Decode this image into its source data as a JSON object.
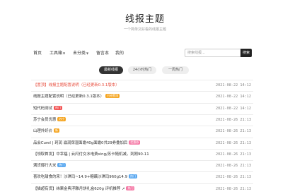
{
  "site": {
    "title": "线报主题",
    "subtitle": "一个简单又好看的线报主题"
  },
  "nav": {
    "items": [
      {
        "label": "首页"
      },
      {
        "label": "工具箱"
      },
      {
        "label": "未分类"
      },
      {
        "label": "留言本"
      },
      {
        "label": "我的"
      }
    ],
    "search_placeholder": "搜索线报...",
    "search_button": "搜索"
  },
  "tabs": [
    {
      "label": "最新线报",
      "active": true
    },
    {
      "label": "24小时热门",
      "active": false
    },
    {
      "label": "一周热门",
      "active": false
    }
  ],
  "news": [
    {
      "title": "【置顶】线报主题配置说明（已经更新0.3.1版本）",
      "color": "red",
      "badge": "",
      "badge_color": "",
      "time": "2021-08-22 14:12"
    },
    {
      "title": "线报主题配置说明（已经更新0.3.1版本）",
      "color": "normal",
      "badge": "已经置顶",
      "badge_color": "orange",
      "time": "2021-08-22 14:12"
    },
    {
      "title": "短代码测试",
      "color": "normal",
      "badge": "热门",
      "badge_color": "red",
      "time": "2021-08-22 14:12"
    },
    {
      "title": "苏宁会员优惠",
      "color": "normal",
      "badge": "苏宁",
      "badge_color": "orange",
      "time": "2021-08-26 21:13"
    },
    {
      "title": "山理外好价",
      "color": "normal",
      "badge": "新",
      "badge_color": "orange",
      "time": "2021-08-26 21:13"
    },
    {
      "title": "品会Curel | 珂润 滋润保湿面霜40g面霜0共29券叠加后",
      "color": "normal",
      "badge": "优惠券",
      "badge_color": "pink",
      "time": "2021-08-26 21:13"
    },
    {
      "title": "【领取首发】中幸福 | 云闪付交水电费xing/苏卡随机减，到刚90-11",
      "color": "normal",
      "badge": "",
      "badge_color": "",
      "time": "2021-08-26 21:13"
    },
    {
      "title": "满货爆行大米",
      "color": "normal",
      "badge": "热门",
      "badge_color": "blue",
      "time": "2021-08-26 21:13"
    },
    {
      "title": "喜欢吃甜食的来！沙琪玛~14.9+糖藕沙琪玛960g14.9",
      "color": "normal",
      "badge": "热门",
      "badge_color": "blue",
      "time": "2021-08-26 21:13"
    },
    {
      "title": "【猫超有货】纬果金典浮雕月饼礼盒620g 评机推荐 ↗",
      "color": "normal",
      "badge": "热门",
      "badge_color": "pink",
      "time": "2021-08-26 21:13"
    }
  ]
}
